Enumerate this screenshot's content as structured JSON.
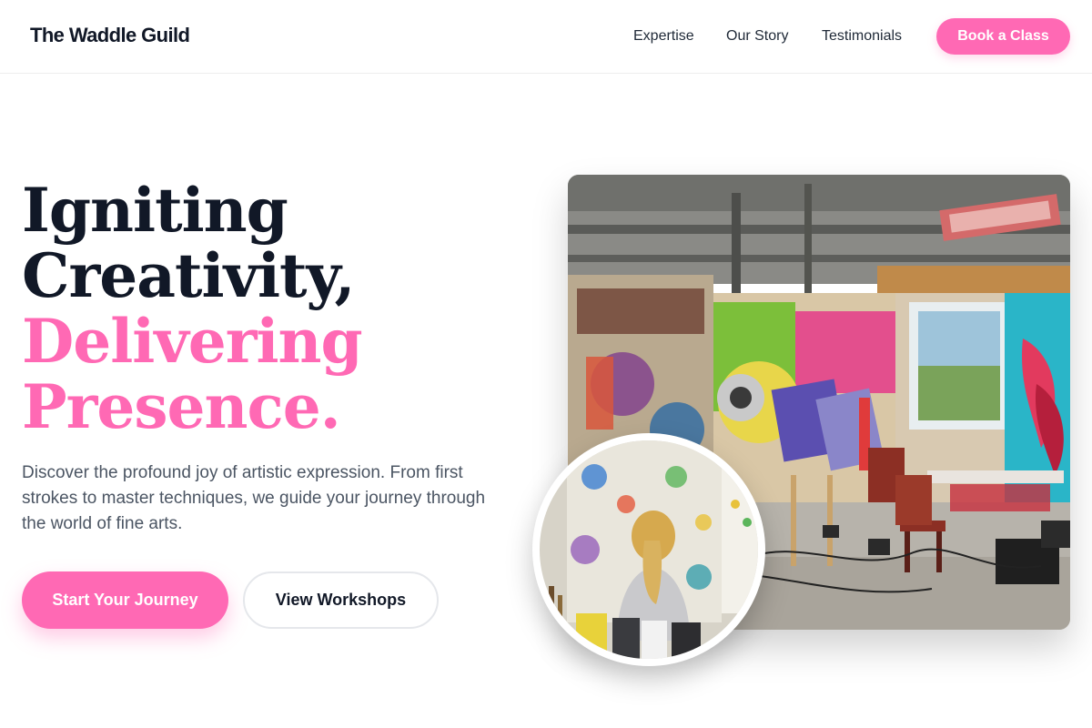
{
  "brand": {
    "name": "The Waddle Guild"
  },
  "nav": {
    "items": [
      {
        "label": "Expertise"
      },
      {
        "label": "Our Story"
      },
      {
        "label": "Testimonials"
      }
    ],
    "cta_label": "Book a Class"
  },
  "hero": {
    "headline": {
      "line1": "Igniting",
      "line2": "Creativity,",
      "line3": "Delivering",
      "line4": "Presence."
    },
    "description": "Discover the profound joy of artistic expression. From first strokes to master techniques, we guide your journey through the world of fine arts.",
    "primary_button": "Start Your Journey",
    "secondary_button": "View Workshops"
  },
  "images": {
    "main": {
      "subject": "graffiti-art-studio"
    },
    "inset": {
      "subject": "child-painting-at-easel"
    }
  },
  "colors": {
    "accent": "#ff69b4",
    "text_dark": "#111827",
    "text_muted": "#4b5563",
    "border": "#e5e7eb"
  }
}
